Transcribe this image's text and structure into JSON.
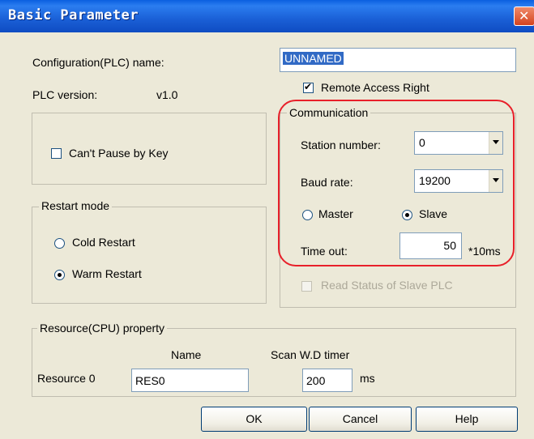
{
  "window": {
    "title": "Basic Parameter",
    "close_symbol": "✕"
  },
  "config": {
    "name_label": "Configuration(PLC) name:",
    "name_value": "UNNAMED",
    "version_label": "PLC version:",
    "version_value": "v1.0"
  },
  "cant_pause": {
    "label": "Can't Pause by Key",
    "checked": false
  },
  "restart": {
    "legend": "Restart mode",
    "cold_label": "Cold Restart",
    "warm_label": "Warm Restart",
    "selected": "warm"
  },
  "remote_access": {
    "label": "Remote Access Right",
    "check_symbol": "✔",
    "checked": true
  },
  "communication": {
    "legend": "Communication",
    "station_label": "Station number:",
    "station_value": "0",
    "baud_label": "Baud rate:",
    "baud_value": "19200",
    "master_label": "Master",
    "slave_label": "Slave",
    "selected_mode": "slave",
    "timeout_label": "Time out:",
    "timeout_value": "50",
    "timeout_unit": "*10ms",
    "highlight_color": "#e8202a"
  },
  "read_status": {
    "label": "Read Status of Slave PLC",
    "enabled": false
  },
  "resource": {
    "legend": "Resource(CPU) property",
    "name_header": "Name",
    "timer_header": "Scan W.D timer",
    "row_label": "Resource 0",
    "name_value": "RES0",
    "timer_value": "200",
    "timer_unit": "ms"
  },
  "buttons": {
    "ok": "OK",
    "cancel": "Cancel",
    "help": "Help"
  },
  "icons": {
    "close": "close-icon",
    "dropdown": "chevron-down-icon"
  }
}
